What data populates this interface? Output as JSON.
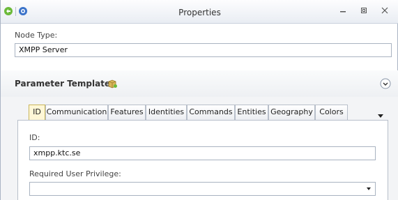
{
  "window": {
    "title": "Properties"
  },
  "node": {
    "type_label": "Node Type:",
    "type_value": "XMPP Server"
  },
  "parameters": {
    "title": "Parameter Templates"
  },
  "tabs": [
    "ID",
    "Communication",
    "Features",
    "Identities",
    "Commands",
    "Entities",
    "Geography",
    "Colors"
  ],
  "active_tab": "ID",
  "id_panel": {
    "id_label": "ID:",
    "id_value": "xmpp.ktc.se",
    "privilege_label": "Required User Privilege:",
    "privilege_value": ""
  },
  "icons": {
    "title_left": [
      "green-arrow-icon",
      "info-icon"
    ],
    "window_buttons": [
      "minimize-icon",
      "restore-icon",
      "close-icon"
    ],
    "parameter_templates": "package-icon",
    "collapse": "chevron-down-icon",
    "tab_overflow": "dropdown-arrow-icon"
  }
}
